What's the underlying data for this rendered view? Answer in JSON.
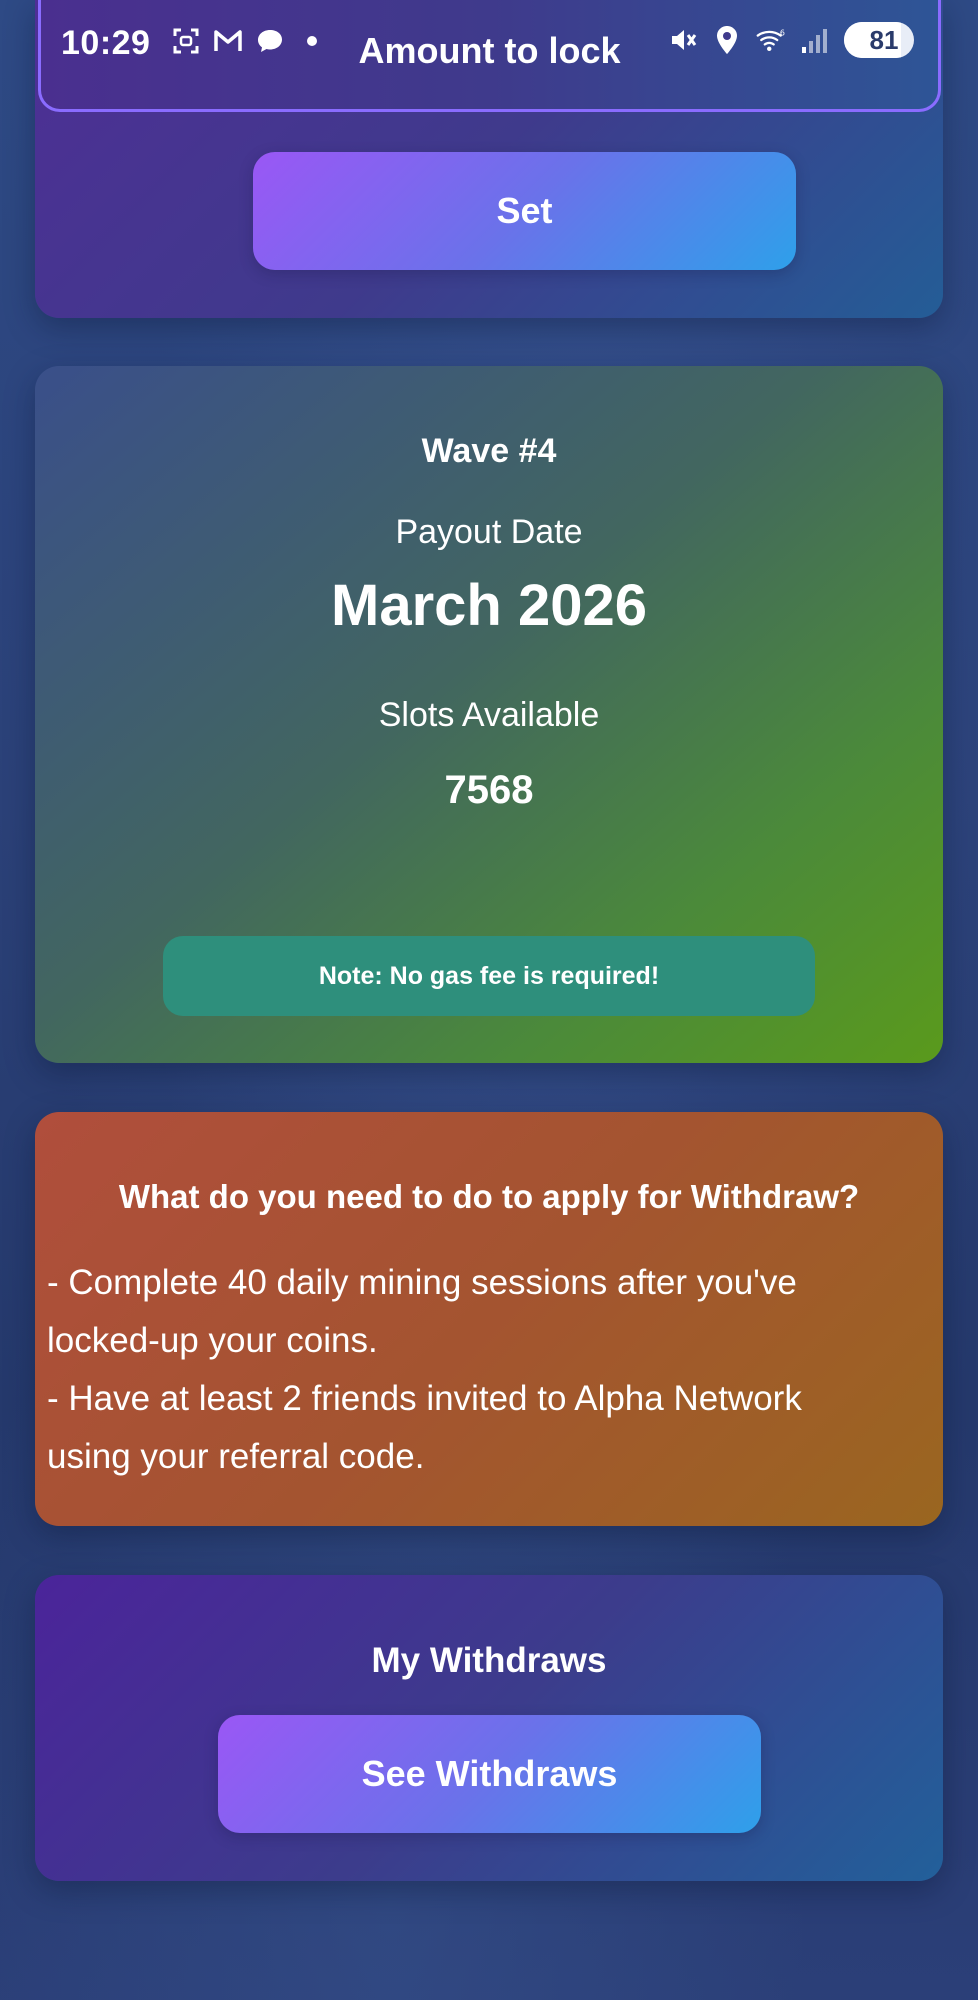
{
  "status_bar": {
    "time": "10:29",
    "battery": "81",
    "battery_level": 0.81,
    "notification_icons": [
      "screenshot-icon",
      "gmail-icon",
      "chat-bubble-icon",
      "dot-icon"
    ],
    "system_icons": [
      "mute-icon",
      "location-icon",
      "wifi-icon",
      "signal-icon",
      "battery-icon"
    ]
  },
  "header": {
    "title": "Amount to lock"
  },
  "lock_card": {
    "set_label": "Set"
  },
  "wave_card": {
    "title": "Wave #4",
    "payout_label": "Payout Date",
    "payout_date": "March 2026",
    "slots_label": "Slots Available",
    "slots_value": "7568",
    "note": "Note: No gas fee is required!"
  },
  "requirements_card": {
    "title": "What do you need to do to apply for Withdraw?",
    "lines": [
      "- Complete 40 daily mining sessions after you've",
      "locked-up your coins.",
      "- Have at least 2 friends invited to Alpha Network",
      "using your referral code."
    ]
  },
  "withdraws_card": {
    "title": "My Withdraws",
    "button_label": "See Withdraws"
  },
  "colors": {
    "accent_purple": "#9a57f5",
    "accent_blue": "#2ea0ea",
    "note_teal": "#2e8f7c",
    "requirements_orange": "#a45430",
    "wave_green": "#4b8a3a"
  }
}
